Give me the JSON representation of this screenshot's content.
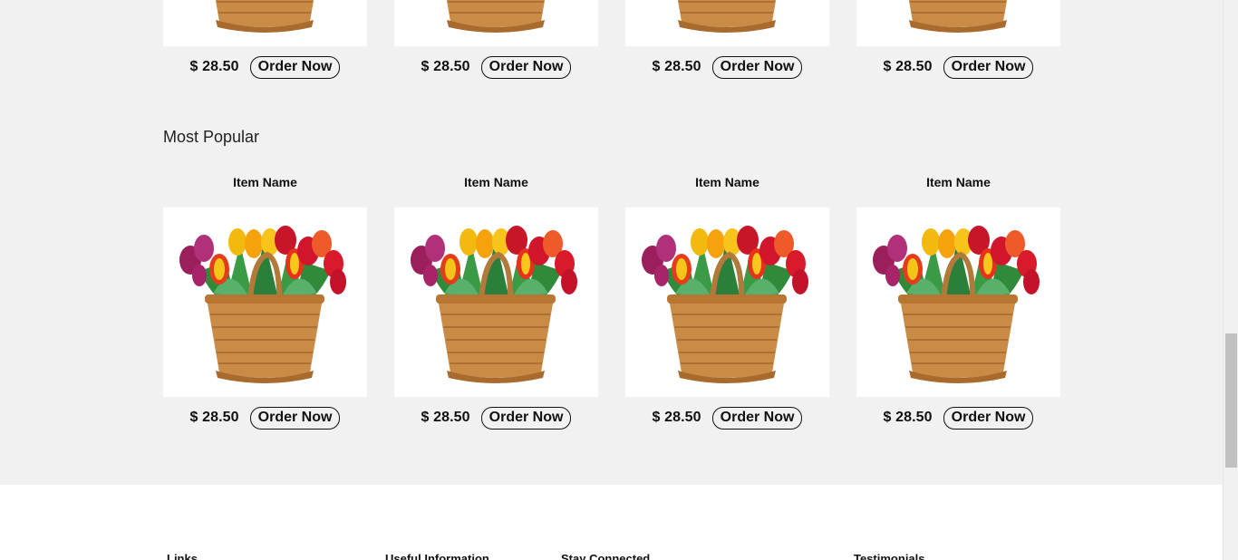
{
  "top_row": {
    "cards": [
      {
        "price": "$ 28.50",
        "button": "Order Now"
      },
      {
        "price": "$ 28.50",
        "button": "Order Now"
      },
      {
        "price": "$ 28.50",
        "button": "Order Now"
      },
      {
        "price": "$ 28.50",
        "button": "Order Now"
      }
    ]
  },
  "most_popular": {
    "title": "Most Popular",
    "cards": [
      {
        "name": "Item Name",
        "price": "$ 28.50",
        "button": "Order Now"
      },
      {
        "name": "Item Name",
        "price": "$ 28.50",
        "button": "Order Now"
      },
      {
        "name": "Item Name",
        "price": "$ 28.50",
        "button": "Order Now"
      },
      {
        "name": "Item Name",
        "price": "$ 28.50",
        "button": "Order Now"
      }
    ]
  },
  "footer": {
    "columns": [
      "Links",
      "Useful Information",
      "Stay Connected",
      "Testimonials"
    ]
  },
  "image": {
    "icon": "tulip-basket-image"
  }
}
